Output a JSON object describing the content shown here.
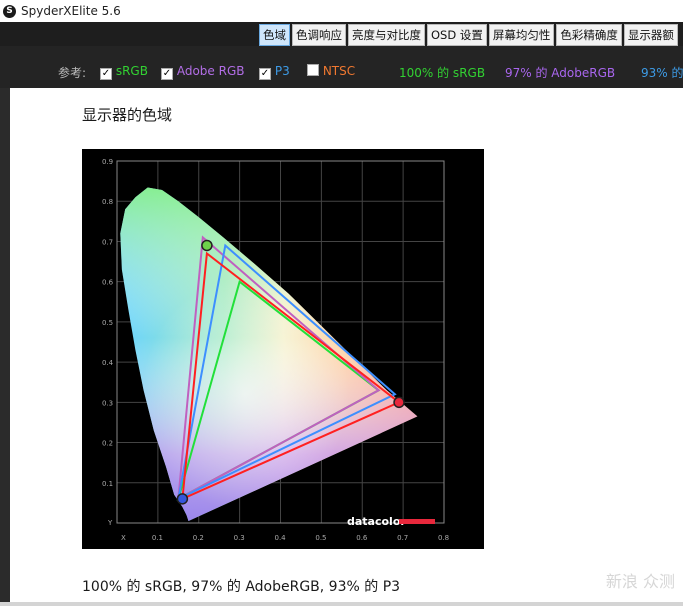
{
  "window": {
    "title": "SpyderXElite 5.6",
    "icon": "S"
  },
  "tabs": [
    {
      "label": "色域",
      "active": true
    },
    {
      "label": "色调响应"
    },
    {
      "label": "亮度与对比度"
    },
    {
      "label": "OSD 设置"
    },
    {
      "label": "屏幕均匀性"
    },
    {
      "label": "色彩精确度"
    },
    {
      "label": "显示器额"
    }
  ],
  "reference": {
    "label": "参考:",
    "options": [
      {
        "label": "sRGB",
        "checked": true,
        "color": "#32d232"
      },
      {
        "label": "Adobe RGB",
        "checked": true,
        "color": "#b26ee6"
      },
      {
        "label": "P3",
        "checked": true,
        "color": "#3d9be6"
      },
      {
        "label": "NTSC",
        "checked": false,
        "color": "#f07830"
      }
    ],
    "results": [
      {
        "label": "100% 的 sRGB",
        "color": "#32d232"
      },
      {
        "label": "97% 的 AdobeRGB",
        "color": "#a966ee"
      },
      {
        "label": "93% 的",
        "color": "#3d9be6"
      }
    ]
  },
  "section": {
    "title": "显示器的色域",
    "caption": "100% 的 sRGB, 97% 的 AdobeRGB, 93% 的 P3"
  },
  "chart_data": {
    "type": "scatter",
    "title": "",
    "xlabel": "X",
    "ylabel": "Y",
    "xlim": [
      0,
      0.8
    ],
    "ylim": [
      0,
      0.9
    ],
    "x_ticks": [
      "0.1",
      "0.2",
      "0.3",
      "0.4",
      "0.5",
      "0.6",
      "0.7",
      "0.8"
    ],
    "y_ticks": [
      "0.1",
      "0.2",
      "0.3",
      "0.4",
      "0.5",
      "0.6",
      "0.7",
      "0.8",
      "0.9"
    ],
    "grid": true,
    "series": [
      {
        "color": "#22e03a",
        "points": [
          [
            0.64,
            0.33
          ],
          [
            0.3,
            0.6
          ],
          [
            0.15,
            0.06
          ]
        ]
      },
      {
        "color": "#c060c0",
        "points": [
          [
            0.64,
            0.33
          ],
          [
            0.21,
            0.71
          ],
          [
            0.15,
            0.06
          ]
        ]
      },
      {
        "color": "#3d8fff",
        "points": [
          [
            0.68,
            0.32
          ],
          [
            0.265,
            0.69
          ],
          [
            0.15,
            0.06
          ]
        ]
      },
      {
        "color": "#ff2020",
        "points": [
          [
            0.69,
            0.3
          ],
          [
            0.22,
            0.67
          ],
          [
            0.16,
            0.06
          ]
        ]
      }
    ],
    "measured_points": [
      {
        "x": 0.22,
        "y": 0.69,
        "color": "#6ed24a"
      },
      {
        "x": 0.69,
        "y": 0.3,
        "color": "#e8283c"
      },
      {
        "x": 0.16,
        "y": 0.06,
        "color": "#3456dc"
      }
    ],
    "brand": "datacolor"
  },
  "watermark": "新浪 众测"
}
